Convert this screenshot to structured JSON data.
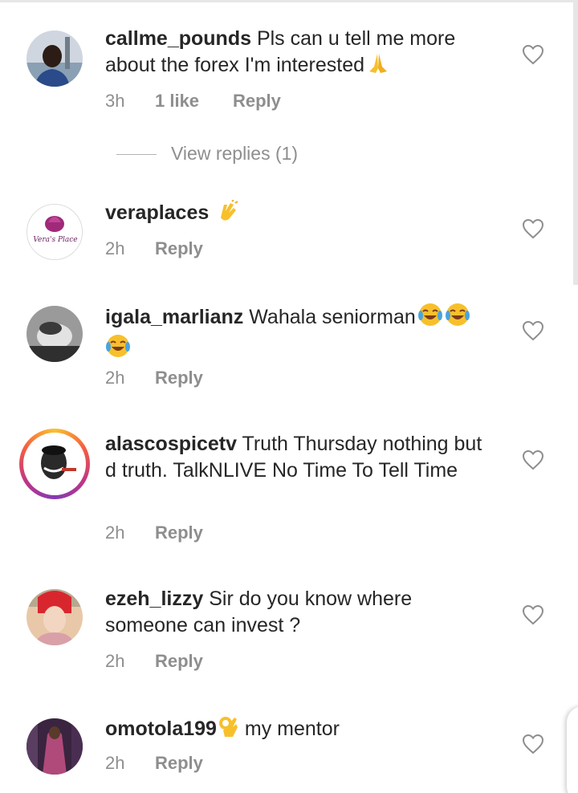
{
  "comments": [
    {
      "username": "callme_pounds",
      "text": " Pls can u tell me more about the forex I'm interested",
      "emoji": "folded-hands",
      "time": "3h",
      "likes": "1 like",
      "reply": "Reply",
      "view_replies": "View replies (1)",
      "avatar": "profile-photo-man"
    },
    {
      "username": "veraplaces",
      "text": " ",
      "emoji": "clapping-hands",
      "time": "2h",
      "reply": "Reply",
      "avatar": "veras-place-logo",
      "avatar_logo_text": "Vera's Place"
    },
    {
      "username": "igala_marlianz",
      "text": " Wahala seniorman",
      "emoji": "face-with-tears-of-joy x3",
      "time": "2h",
      "reply": "Reply",
      "avatar": "profile-photo-bw"
    },
    {
      "username": "alascospicetv",
      "text": " Truth Thursday nothing but d truth. TalkNLIVE No Time To Tell Time",
      "time": "2h",
      "reply": "Reply",
      "avatar": "profile-illustration-story-ring"
    },
    {
      "username": "ezeh_lizzy",
      "text": " Sir do you know where someone can invest ?",
      "time": "2h",
      "reply": "Reply",
      "avatar": "profile-photo-woman"
    },
    {
      "username": "omotola199",
      "text": " my mentor",
      "emoji": "ok-hand",
      "time": "2h",
      "reply": "Reply",
      "avatar": "profile-photo-fashion"
    }
  ],
  "colors": {
    "text": "#262626",
    "secondary": "#8e8e8e",
    "divider": "#e6e6e6",
    "emoji_yellow": "#f7c02b"
  }
}
